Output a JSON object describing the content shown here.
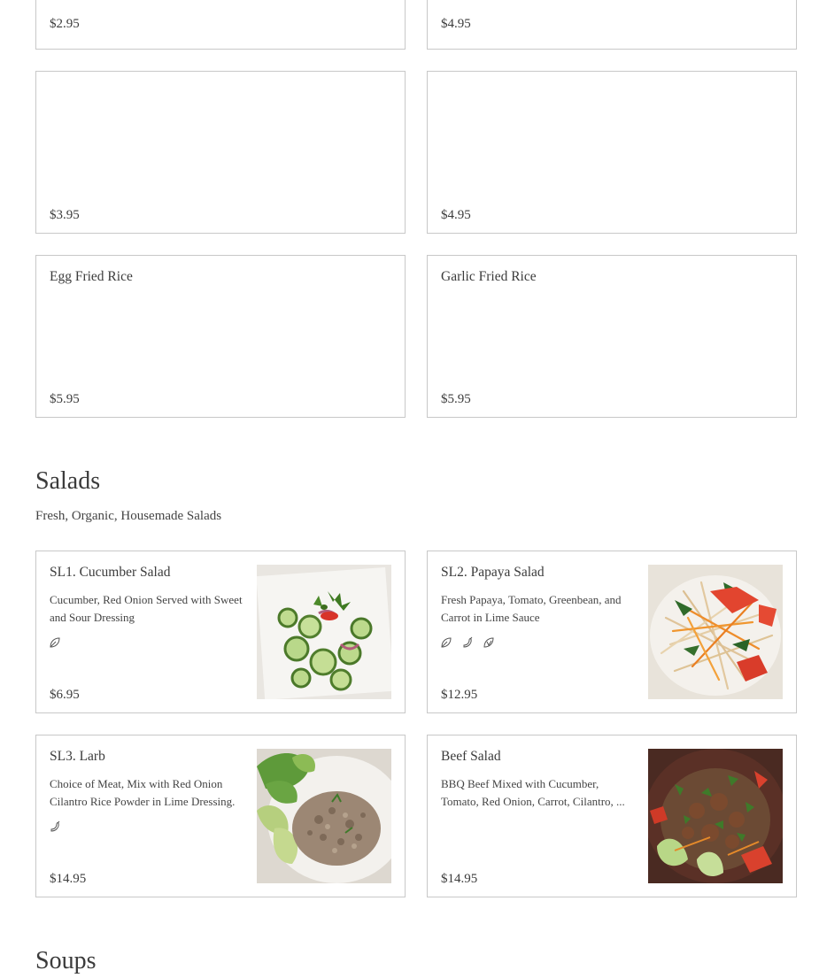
{
  "top_row": {
    "left": {
      "price": "$2.95"
    },
    "right": {
      "price": "$4.95"
    }
  },
  "row2": {
    "left": {
      "price": "$3.95"
    },
    "right": {
      "price": "$4.95"
    }
  },
  "row3": {
    "left": {
      "name": "Egg Fried Rice",
      "price": "$5.95"
    },
    "right": {
      "name": "Garlic Fried Rice",
      "price": "$5.95"
    }
  },
  "salads": {
    "title": "Salads",
    "subtitle": "Fresh, Organic, Housemade Salads",
    "items": [
      {
        "name": "SL1. Cucumber Salad",
        "desc": "Cucumber, Red Onion Served with Sweet and Sour Dressing",
        "icons": [
          "vegetarian-icon"
        ],
        "price": "$6.95"
      },
      {
        "name": "SL2. Papaya Salad",
        "desc": "Fresh Papaya, Tomato, Greenbean, and Carrot in Lime Sauce",
        "icons": [
          "vegetarian-icon",
          "spicy-icon",
          "vegan-icon"
        ],
        "price": "$12.95"
      },
      {
        "name": "SL3. Larb",
        "desc": "Choice of Meat, Mix with Red Onion Cilantro Rice Powder in Lime Dressing.",
        "icons": [
          "spicy-icon"
        ],
        "price": "$14.95"
      },
      {
        "name": "Beef Salad",
        "desc_line1": "BBQ Beef Mixed with Cucumber,",
        "desc_line2": "Tomato, Red Onion, Carrot, Cilantro, ...",
        "price": "$14.95"
      }
    ]
  },
  "soups": {
    "title": "Soups"
  }
}
